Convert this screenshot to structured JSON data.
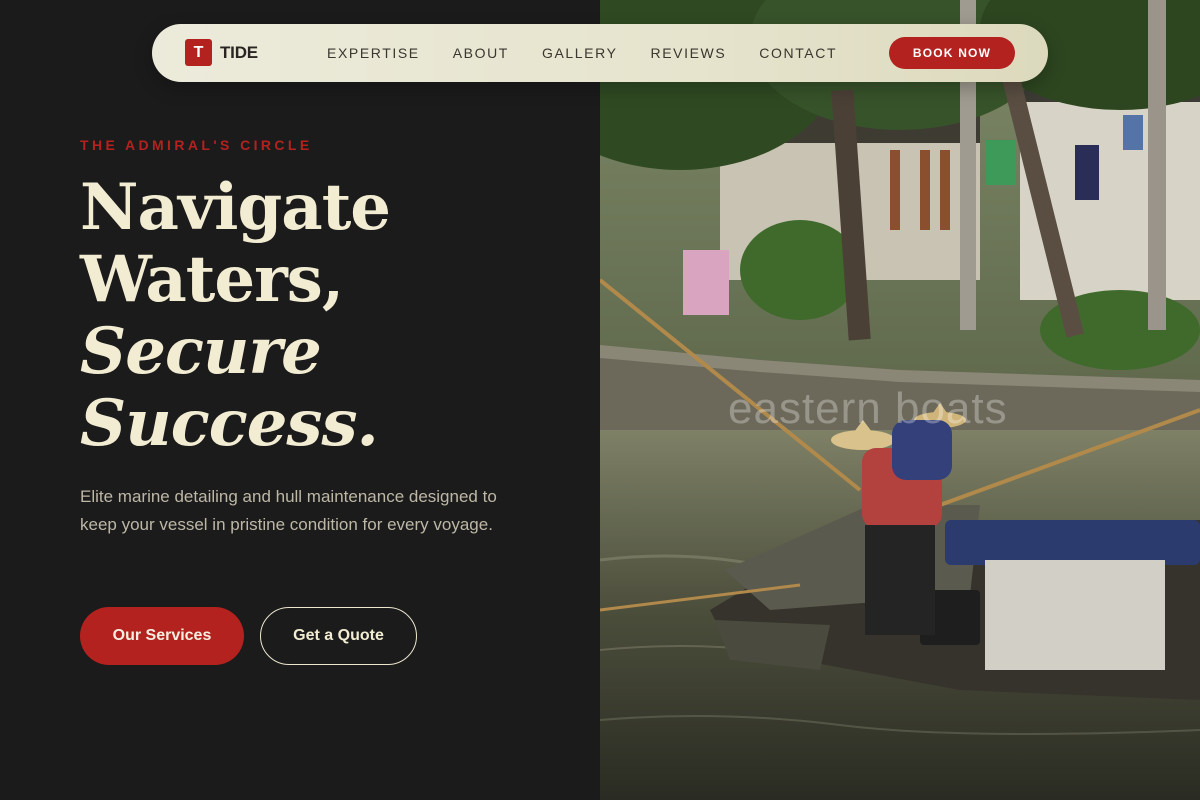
{
  "brand": {
    "logo_letter": "T",
    "name": "TIDE"
  },
  "nav": {
    "links": [
      "EXPERTISE",
      "ABOUT",
      "GALLERY",
      "REVIEWS",
      "CONTACT"
    ],
    "cta": "BOOK NOW"
  },
  "hero": {
    "eyebrow": "THE ADMIRAL'S CIRCLE",
    "headline": [
      "Navigate",
      "Waters,",
      "Secure",
      "Success."
    ],
    "description": "Elite marine detailing and hull maintenance designed to keep your vessel in pristine condition for every voyage.",
    "primary_button": "Our Services",
    "secondary_button": "Get a Quote"
  },
  "image": {
    "watermark": "eastern boats"
  },
  "colors": {
    "accent": "#b3221f",
    "background": "#1c1b1b",
    "headline": "#f1ecd2",
    "nav_bg": "#e8e6d0"
  }
}
